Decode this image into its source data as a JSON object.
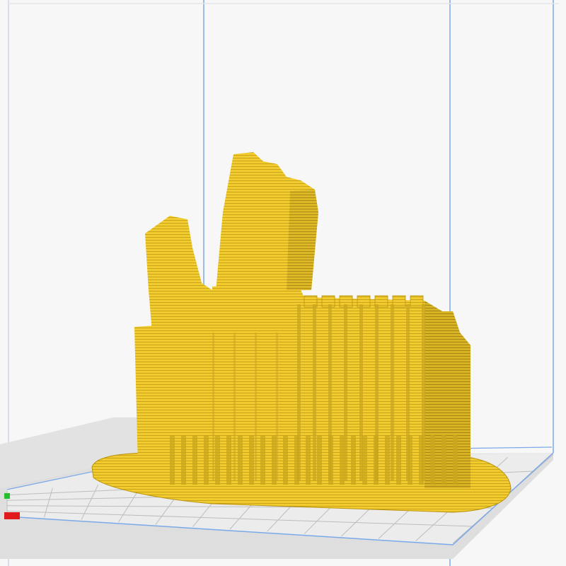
{
  "app": {
    "name": "slicer-3d-viewport",
    "view_mode": "layer-preview"
  },
  "scene": {
    "background_color": "#f7f7f7",
    "build_volume_line_color": "#7aa9e8",
    "build_plate_color": "#d8d8d8",
    "build_plate_grid_color": "#b9b9b9",
    "model_color": "#f2cc2e",
    "model_shadow_color": "#b8930f",
    "model_layer_line_color": "#a4820c",
    "axis_x_color": "#e01b1b",
    "axis_y_color": "#25c02b"
  },
  "icons": {
    "axis_x": "axis-x-indicator",
    "axis_y": "axis-y-indicator"
  }
}
